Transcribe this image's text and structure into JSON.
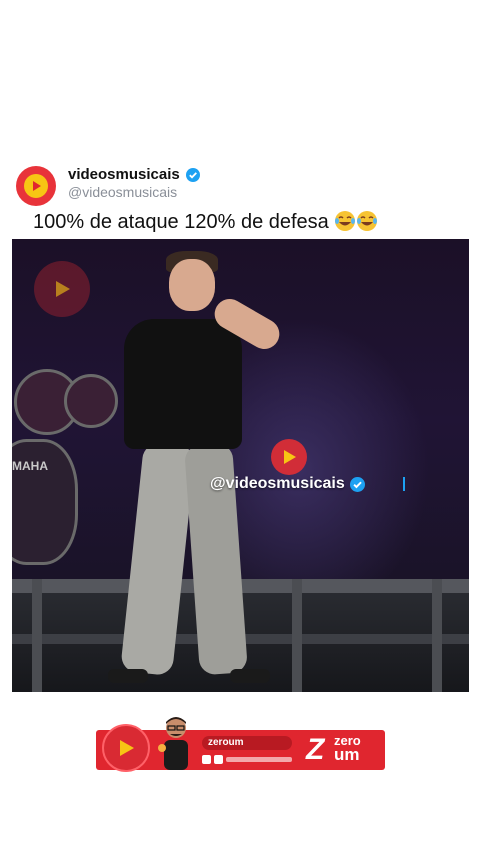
{
  "post": {
    "display_name": "videosmusicais",
    "handle": "@videosmusicais",
    "caption": "100% de ataque 120% de defesa",
    "caption_emoji": "laughing-tears"
  },
  "video": {
    "watermark_handle": "@videosmusicais",
    "drum_brand_text": "MAHA"
  },
  "banner": {
    "pill_text": "zeroum",
    "brand_zero": "zero",
    "brand_um": "um"
  },
  "colors": {
    "brand_red": "#e0262f",
    "verified_blue": "#1da1f2",
    "play_yellow": "#f7c514"
  },
  "icons": {
    "avatar": "play-logo-icon",
    "verified": "verified-badge-icon"
  }
}
